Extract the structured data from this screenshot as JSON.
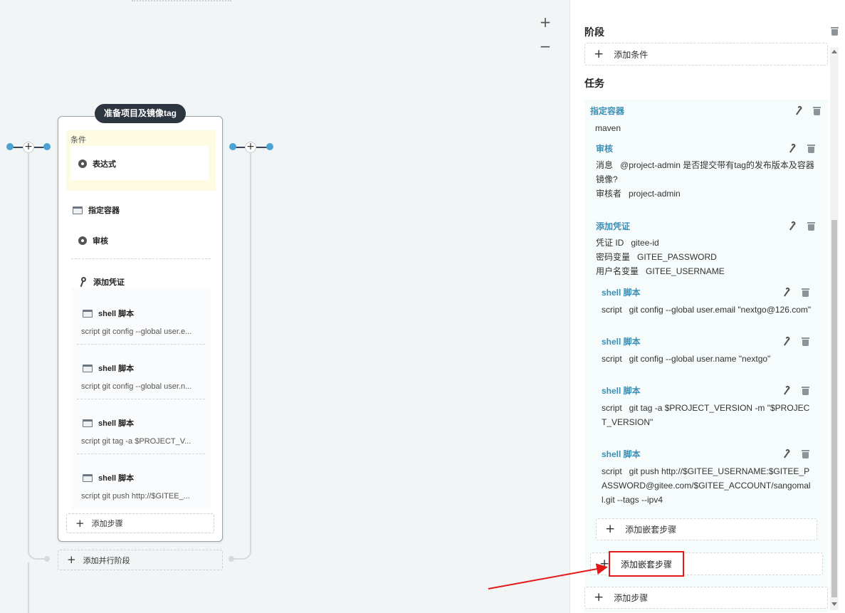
{
  "canvas": {
    "zoom_in": "+",
    "zoom_out": "−",
    "stage": {
      "title": "准备项目及镜像tag",
      "condition_label": "条件",
      "expression_label": "表达式",
      "container_label": "指定容器",
      "review_label": "审核",
      "credential_label": "添加凭证",
      "shell_steps": [
        {
          "title": "shell 脚本",
          "script": "script   git config --global user.e..."
        },
        {
          "title": "shell 脚本",
          "script": "script   git config --global user.n..."
        },
        {
          "title": "shell 脚本",
          "script": "script   git tag -a $PROJECT_V..."
        },
        {
          "title": "shell 脚本",
          "script": "script   git push http://$GITEE_..."
        }
      ],
      "add_step": "添加步骤",
      "add_parallel": "添加并行阶段"
    }
  },
  "panel": {
    "stage_title": "阶段",
    "add_condition": "添加条件",
    "task_title": "任务",
    "container_title": "指定容器",
    "container_value": "maven",
    "review": {
      "title": "审核",
      "message_key": "消息",
      "message_line1": "@project-admin 是否提交带有tag的发布版本及容器",
      "message_line2": "镜像?",
      "reviewer_key": "审核者",
      "reviewer_value": "project-admin"
    },
    "credential": {
      "title": "添加凭证",
      "id_key": "凭证 ID",
      "id_value": "gitee-id",
      "pwd_key": "密码变量",
      "pwd_value": "GITEE_PASSWORD",
      "user_key": "用户名变量",
      "user_value": "GITEE_USERNAME"
    },
    "shell_steps": [
      {
        "title": "shell 脚本",
        "key": "script",
        "lines": [
          "git config --global user.email \"nextgo@126.com\""
        ]
      },
      {
        "title": "shell 脚本",
        "key": "script",
        "lines": [
          "git config --global user.name \"nextgo\""
        ]
      },
      {
        "title": "shell 脚本",
        "key": "script",
        "lines": [
          "git tag -a $PROJECT_VERSION -m \"$PROJEC",
          "T_VERSION\""
        ]
      },
      {
        "title": "shell 脚本",
        "key": "script",
        "lines": [
          "git push http://$GITEE_USERNAME:$GITEE_P",
          "ASSWORD@gitee.com/$GITEE_ACCOUNT/sangomal",
          "l.git --tags --ipv4"
        ]
      }
    ],
    "add_nested_inner": "添加嵌套步骤",
    "add_nested_outer": "添加嵌套步骤",
    "add_step": "添加步骤"
  },
  "colors": {
    "accent": "#3a8fb5",
    "highlight": "#e31919",
    "stage_title_bg": "#2d3541",
    "node_dot": "#4aa3d2"
  }
}
